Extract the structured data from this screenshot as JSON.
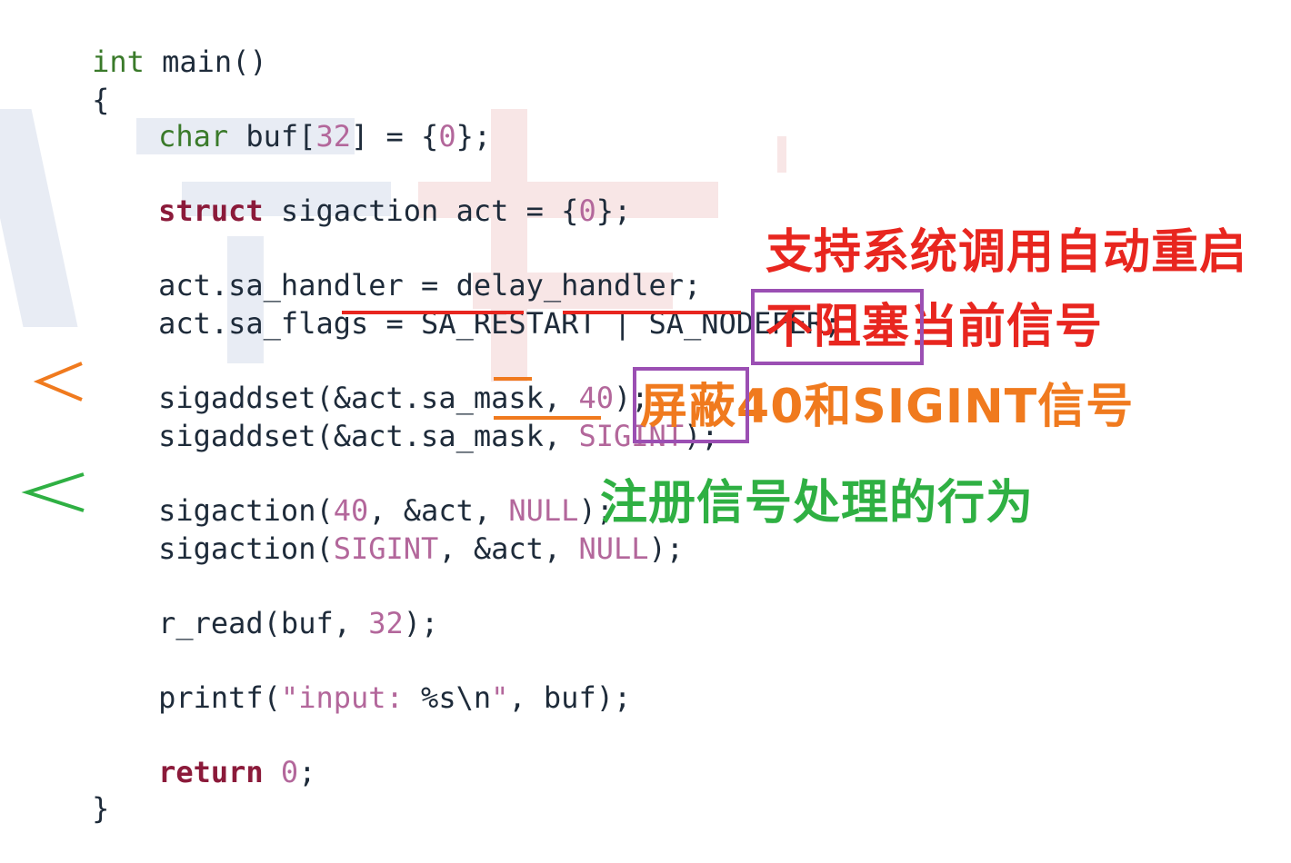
{
  "code": {
    "l1_type": "int",
    "l1_rest": " main()",
    "l2": "{",
    "l3_type": "char",
    "l3_a": " buf[",
    "l3_num": "32",
    "l3_b": "] = {",
    "l3_zero": "0",
    "l3_c": "};",
    "l4_kw": "struct",
    "l4_a": " sigaction act = {",
    "l4_zero": "0",
    "l4_b": "};",
    "l5": "act.sa_handler = delay_handler;",
    "l6_a": "act.sa_flags = ",
    "l6_restart": "SA_RESTART",
    "l6_b": " | ",
    "l6_nodefer": "SA_NODEFER",
    "l6_c": ";",
    "l7_a": "sigaddset(&act.sa_mask, ",
    "l7_num": "40",
    "l7_b": ");",
    "l8_a": "sigaddset(&act.sa_mask, ",
    "l8_sig": "SIGINT",
    "l8_b": ");",
    "l9_a": "sigaction(",
    "l9_num": "40",
    "l9_b": ", &act, ",
    "l9_null": "NULL",
    "l9_c": ");",
    "l10_a": "sigaction(",
    "l10_sig": "SIGINT",
    "l10_b": ", &act, ",
    "l10_null": "NULL",
    "l10_c": ");",
    "l11_a": "r_read(buf, ",
    "l11_num": "32",
    "l11_b": ");",
    "l12_a": "printf(",
    "l12_str": "\"input: ",
    "l12_fmt": "%s\\n",
    "l12_str2": "\"",
    "l12_b": ", buf);",
    "l13_kw": "return",
    "l13_sp": " ",
    "l13_zero": "0",
    "l13_b": ";",
    "l14": "}"
  },
  "annotations": {
    "restart_note": "支持系统调用自动重启",
    "nodefer_boxed": "不阻塞",
    "nodefer_rest": "当前信号",
    "mask_boxed": "屏蔽",
    "mask_rest": "40和SIGINT信号",
    "register_note": "注册信号处理的行为"
  },
  "colors": {
    "red_note": "#e8261f",
    "orange_note": "#f07a1e",
    "green_note": "#2fb043",
    "box": "#9b4fb3"
  },
  "icons": [
    "orange-arrow-icon",
    "green-arrow-icon"
  ]
}
